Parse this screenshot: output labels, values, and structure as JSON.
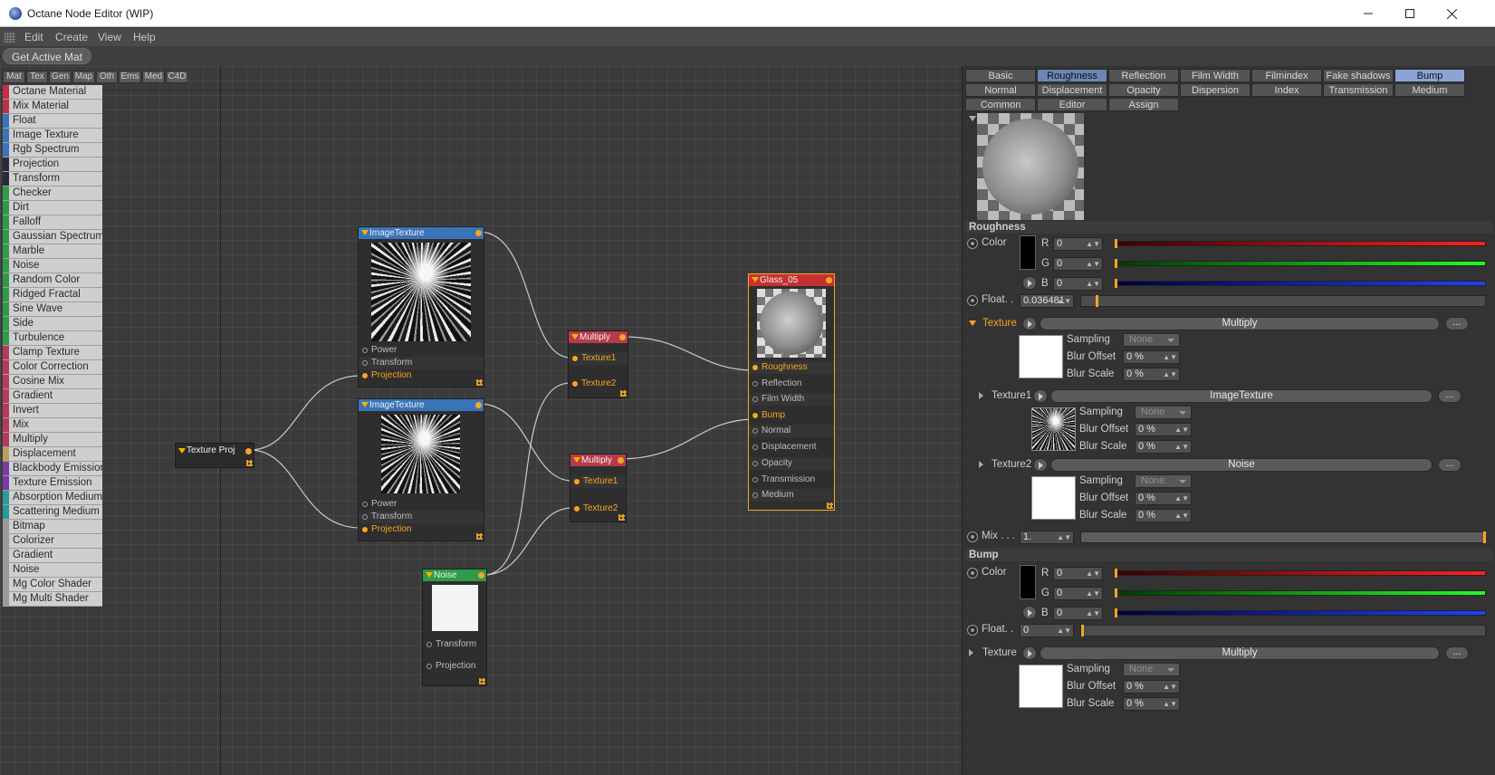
{
  "window": {
    "title": "Octane Node Editor (WIP)"
  },
  "menu": {
    "items": [
      "Edit",
      "Create",
      "View",
      "Help"
    ]
  },
  "toolbar": {
    "get_active_mat": "Get Active Mat"
  },
  "palette": {
    "tabs": [
      "Mat",
      "Tex",
      "Gen",
      "Map",
      "Oth",
      "Ems",
      "Med",
      "C4D"
    ],
    "items": [
      {
        "label": "Octane Material",
        "color": "#c0304a"
      },
      {
        "label": "Mix Material",
        "color": "#c0304a"
      },
      {
        "label": "Float",
        "color": "#3a74b8"
      },
      {
        "label": "Image Texture",
        "color": "#3a74b8"
      },
      {
        "label": "Rgb Spectrum",
        "color": "#3a74b8"
      },
      {
        "label": "Projection",
        "color": "#2a2a3a"
      },
      {
        "label": "Transform",
        "color": "#2a2a3a"
      },
      {
        "label": "Checker",
        "color": "#2f9a48"
      },
      {
        "label": "Dirt",
        "color": "#2f9a48"
      },
      {
        "label": "Falloff",
        "color": "#2f9a48"
      },
      {
        "label": "Gaussian Spectrum",
        "color": "#2f9a48"
      },
      {
        "label": "Marble",
        "color": "#2f9a48"
      },
      {
        "label": "Noise",
        "color": "#2f9a48"
      },
      {
        "label": "Random Color",
        "color": "#2f9a48"
      },
      {
        "label": "Ridged Fractal",
        "color": "#2f9a48"
      },
      {
        "label": "Sine Wave",
        "color": "#2f9a48"
      },
      {
        "label": "Side",
        "color": "#2f9a48"
      },
      {
        "label": "Turbulence",
        "color": "#2f9a48"
      },
      {
        "label": "Clamp Texture",
        "color": "#b83a5a"
      },
      {
        "label": "Color Correction",
        "color": "#b83a5a"
      },
      {
        "label": "Cosine Mix",
        "color": "#b83a5a"
      },
      {
        "label": "Gradient",
        "color": "#b83a5a"
      },
      {
        "label": "Invert",
        "color": "#b83a5a"
      },
      {
        "label": "Mix",
        "color": "#b83a5a"
      },
      {
        "label": "Multiply",
        "color": "#b83a5a"
      },
      {
        "label": "Displacement",
        "color": "#b8a060"
      },
      {
        "label": "Blackbody Emission",
        "color": "#7a3aa8"
      },
      {
        "label": "Texture Emission",
        "color": "#7a3aa8"
      },
      {
        "label": "Absorption Medium",
        "color": "#2a9a9a"
      },
      {
        "label": "Scattering Medium",
        "color": "#2a9a9a"
      },
      {
        "label": "Bitmap",
        "color": "#9a9a9a"
      },
      {
        "label": "Colorizer",
        "color": "#9a9a9a"
      },
      {
        "label": "Gradient",
        "color": "#9a9a9a"
      },
      {
        "label": "Noise",
        "color": "#9a9a9a"
      },
      {
        "label": "Mg Color Shader",
        "color": "#9a9a9a"
      },
      {
        "label": "Mg Multi Shader",
        "color": "#9a9a9a"
      }
    ]
  },
  "nodes": {
    "image_texture_1": {
      "title": "ImageTexture",
      "color": "#3a74b8",
      "pins": [
        "Power",
        "Transform",
        "Projection"
      ]
    },
    "image_texture_2": {
      "title": "ImageTexture",
      "color": "#3a74b8",
      "pins": [
        "Power",
        "Transform",
        "Projection"
      ]
    },
    "texture_proj": {
      "title": "Texture Proj",
      "color": "#2e2e2e"
    },
    "multiply_1": {
      "title": "Multiply",
      "color": "#b83a4a",
      "pins": [
        "Texture1",
        "Texture2"
      ]
    },
    "multiply_2": {
      "title": "Multiply",
      "color": "#b83a4a",
      "pins": [
        "Texture1",
        "Texture2"
      ]
    },
    "noise": {
      "title": "Noise",
      "color": "#2f9a48",
      "pins": [
        "Transform",
        "Projection"
      ]
    },
    "material": {
      "title": "Glass_05",
      "color": "#c83030",
      "pins": [
        "Roughness",
        "Reflection",
        "Film Width",
        "Bump",
        "Normal",
        "Displacement",
        "Opacity",
        "Transmission",
        "Medium"
      ]
    }
  },
  "panel": {
    "tabs_row1": [
      "Basic",
      "Roughness",
      "Reflection",
      "Film Width",
      "Filmindex",
      "Fake shadows",
      "Bump"
    ],
    "tabs_row2": [
      "Normal",
      "Displacement",
      "Opacity",
      "Dispersion",
      "Index",
      "Transmission",
      "Medium"
    ],
    "tabs_row3": [
      "Common",
      "Editor",
      "Assign"
    ],
    "roughness": {
      "section": "Roughness",
      "color_label": "Color",
      "r_label": "R",
      "r": "0",
      "g_label": "G",
      "g": "0",
      "b_label": "B",
      "b": "0",
      "float_label": "Float. .",
      "float_value": "0.036481",
      "float_level": 0.036481,
      "texture_label": "Texture",
      "texture_value": "Multiply",
      "sampling_label": "Sampling",
      "sampling_value": "None",
      "blur_offset_label": "Blur Offset",
      "blur_offset": "0 %",
      "blur_scale_label": "Blur Scale",
      "blur_scale": "0 %",
      "texture1_label": "Texture1",
      "texture1_value": "ImageTexture",
      "t1_sampling": "None",
      "t1_blur_offset": "0 %",
      "t1_blur_scale": "0 %",
      "texture2_label": "Texture2",
      "texture2_value": "Noise",
      "t2_sampling": "None",
      "t2_blur_offset": "0 %",
      "t2_blur_scale": "0 %",
      "mix_label": "Mix . . .",
      "mix_value": "1.",
      "more": "..."
    },
    "bump": {
      "section": "Bump",
      "color_label": "Color",
      "r_label": "R",
      "r": "0",
      "g_label": "G",
      "g": "0",
      "b_label": "B",
      "b": "0",
      "float_label": "Float. .",
      "float_value": "0",
      "texture_label": "Texture",
      "texture_value": "Multiply",
      "sampling_label": "Sampling",
      "sampling_value": "None",
      "blur_offset_label": "Blur Offset",
      "blur_offset": "0 %",
      "blur_scale_label": "Blur Scale",
      "blur_scale": "0 %",
      "more": "..."
    }
  }
}
